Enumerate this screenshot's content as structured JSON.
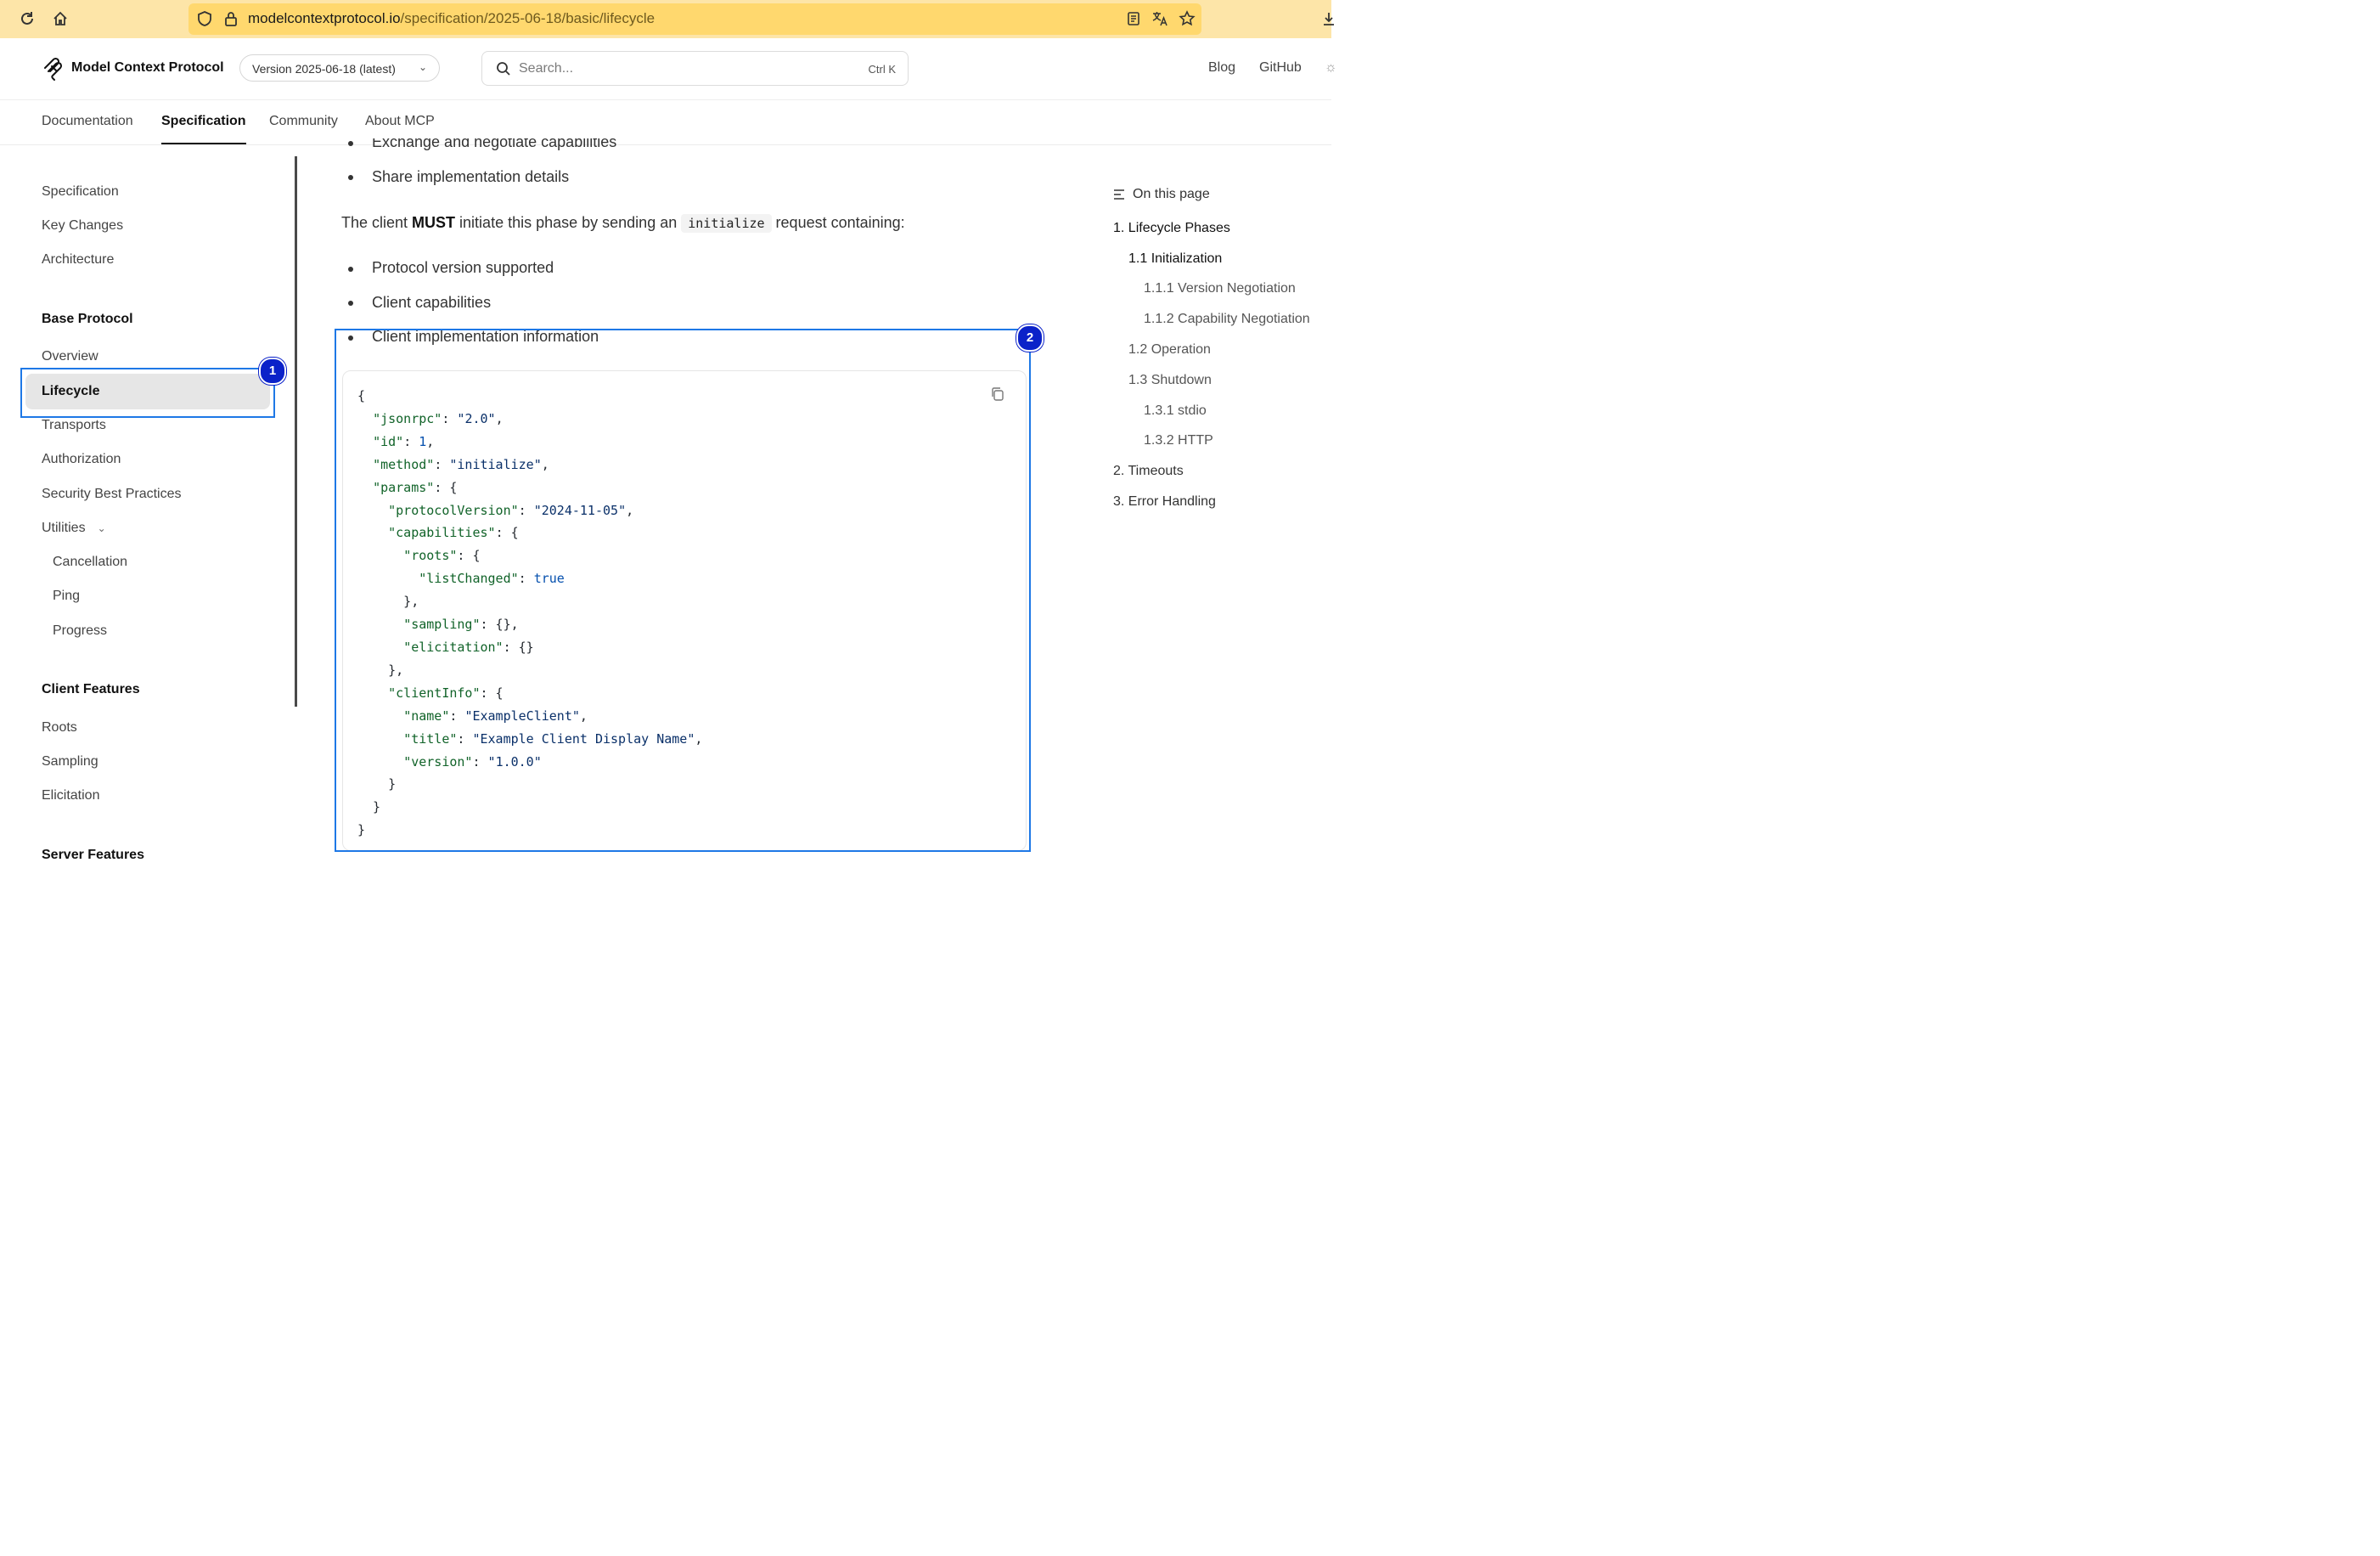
{
  "browser": {
    "url_domain": "modelcontextprotocol.io",
    "url_path": "/specification/2025-06-18/basic/lifecycle"
  },
  "header": {
    "brand": "Model Context Protocol",
    "version": "Version 2025-06-18 (latest)",
    "search_placeholder": "Search...",
    "search_shortcut": "Ctrl K",
    "links": [
      "Blog",
      "GitHub"
    ]
  },
  "tabs": [
    "Documentation",
    "Specification",
    "Community",
    "About MCP"
  ],
  "sidebar": {
    "top_items": [
      "Specification",
      "Key Changes",
      "Architecture"
    ],
    "base_protocol_heading": "Base Protocol",
    "base_items": [
      "Overview",
      "Lifecycle",
      "Transports",
      "Authorization",
      "Security Best Practices",
      "Utilities"
    ],
    "utility_items": [
      "Cancellation",
      "Ping",
      "Progress"
    ],
    "client_features_heading": "Client Features",
    "client_items": [
      "Roots",
      "Sampling",
      "Elicitation"
    ],
    "server_features_heading": "Server Features"
  },
  "content": {
    "bullets_top": [
      "Exchange and negotiate capabilities",
      "Share implementation details"
    ],
    "para_before": "The client ",
    "para_must": "MUST",
    "para_mid": " initiate this phase by sending an ",
    "para_code": "initialize",
    "para_after": " request containing:",
    "bullets": [
      "Protocol version supported",
      "Client capabilities",
      "Client implementation information"
    ],
    "code_values": {
      "jsonrpc": "2.0",
      "id": "1",
      "method": "initialize",
      "protocolVersion": "2024-11-05",
      "listChanged": "true",
      "name": "ExampleClient",
      "title": "Example Client Display Name",
      "version": "1.0.0"
    }
  },
  "toc": {
    "heading": "On this page",
    "items": [
      "1. Lifecycle Phases",
      "1.1 Initialization",
      "1.1.1 Version Negotiation",
      "1.1.2 Capability Negotiation",
      "1.2 Operation",
      "1.3 Shutdown",
      "1.3.1 stdio",
      "1.3.2 HTTP",
      "2. Timeouts",
      "3. Error Handling"
    ]
  },
  "annotations": [
    "1",
    "2"
  ],
  "colors": {
    "annotation": "#1e78e6",
    "badge": "#0b22c9",
    "urlbar": "#ffd86e"
  }
}
